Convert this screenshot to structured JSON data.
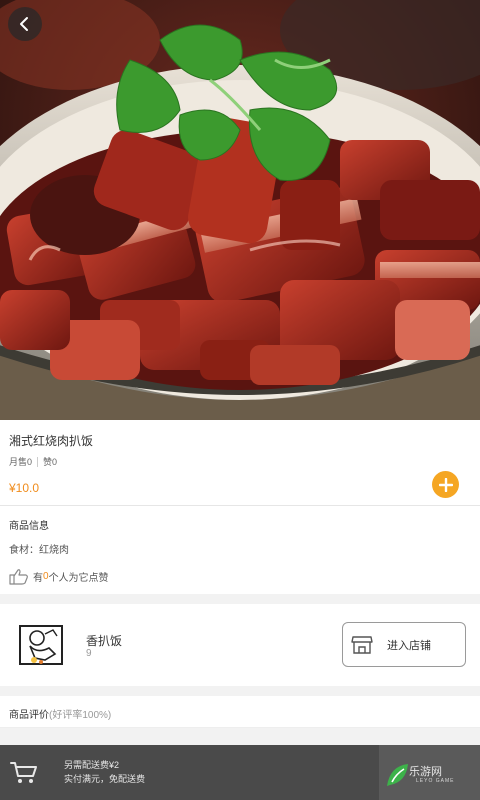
{
  "hero": {
    "image_description_icon": "braised-pork-dish-photo"
  },
  "product": {
    "name": "湘式红烧肉扒饭",
    "monthly_sales": "月售0",
    "likes": "赞0",
    "price": "¥10.0"
  },
  "goods_info": {
    "title": "商品信息",
    "ingredients": "食材：红烧肉",
    "like_prefix": "有",
    "like_count": "0",
    "like_suffix": "个人为它点赞"
  },
  "shop": {
    "name": "香扒饭",
    "sub": "9",
    "enter_label": "进入店铺"
  },
  "reviews": {
    "title": "商品评价",
    "rate": "(好评率100%)"
  },
  "bottom_bar": {
    "delivery_fee": "另需配送费¥2",
    "delivery_note": "实付满元，免配送费"
  },
  "watermark": {
    "text": "乐游网",
    "sub": "LEYO GAME"
  },
  "colors": {
    "accent": "#f08c1c",
    "add_button": "#f5a623",
    "bottom_bar": "#4a4a4a"
  }
}
